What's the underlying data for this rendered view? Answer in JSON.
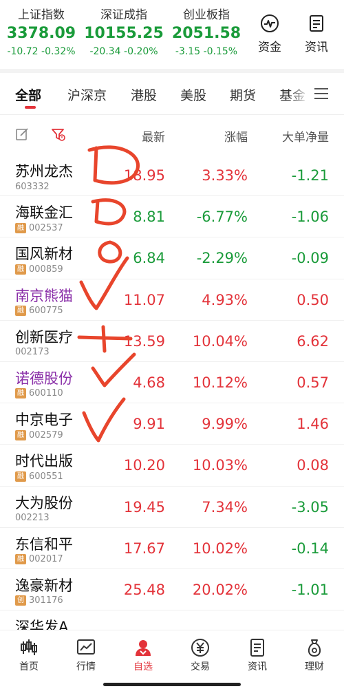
{
  "indices": [
    {
      "name": "上证指数",
      "value": "3378.09",
      "change": "-10.72",
      "pct": "-0.32%"
    },
    {
      "name": "深证成指",
      "value": "10155.25",
      "change": "-20.34",
      "pct": "-0.20%"
    },
    {
      "name": "创业板指",
      "value": "2051.58",
      "change": "-3.15",
      "pct": "-0.15%"
    }
  ],
  "top_buttons": {
    "funds": "资金",
    "news": "资讯"
  },
  "tabs": [
    "全部",
    "沪深京",
    "港股",
    "美股",
    "期货",
    "基金"
  ],
  "header": {
    "latest": "最新",
    "change": "涨幅",
    "net": "大单净量"
  },
  "stocks": [
    {
      "name": "苏州龙杰",
      "code": "603332",
      "tag": "",
      "price": "18.95",
      "pct": "3.33%",
      "net": "-1.21"
    },
    {
      "name": "海联金汇",
      "code": "002537",
      "tag": "融",
      "price": "8.81",
      "pct": "-6.77%",
      "net": "-1.06"
    },
    {
      "name": "国风新材",
      "code": "000859",
      "tag": "融",
      "price": "6.84",
      "pct": "-2.29%",
      "net": "-0.09"
    },
    {
      "name": "南京熊猫",
      "code": "600775",
      "tag": "融",
      "price": "11.07",
      "pct": "4.93%",
      "net": "0.50"
    },
    {
      "name": "创新医疗",
      "code": "002173",
      "tag": "",
      "price": "13.59",
      "pct": "10.04%",
      "net": "6.62"
    },
    {
      "name": "诺德股份",
      "code": "600110",
      "tag": "融",
      "price": "4.68",
      "pct": "10.12%",
      "net": "0.57"
    },
    {
      "name": "中京电子",
      "code": "002579",
      "tag": "融",
      "price": "9.91",
      "pct": "9.99%",
      "net": "1.46"
    },
    {
      "name": "时代出版",
      "code": "600551",
      "tag": "融",
      "price": "10.20",
      "pct": "10.03%",
      "net": "0.08"
    },
    {
      "name": "大为股份",
      "code": "002213",
      "tag": "",
      "price": "19.45",
      "pct": "7.34%",
      "net": "-3.05"
    },
    {
      "name": "东信和平",
      "code": "002017",
      "tag": "融",
      "price": "17.67",
      "pct": "10.02%",
      "net": "-0.14"
    },
    {
      "name": "逸豪新材",
      "code": "301176",
      "tag": "创",
      "price": "25.48",
      "pct": "20.02%",
      "net": "-1.01"
    },
    {
      "name": "深华发A",
      "code": "",
      "tag": "",
      "price": "",
      "pct": "",
      "net": ""
    }
  ],
  "nav": [
    {
      "label": "首页",
      "icon": "candlestick-icon"
    },
    {
      "label": "行情",
      "icon": "chart-icon"
    },
    {
      "label": "自选",
      "icon": "person-icon"
    },
    {
      "label": "交易",
      "icon": "yuan-icon"
    },
    {
      "label": "资讯",
      "icon": "news-icon"
    },
    {
      "label": "理财",
      "icon": "moneybag-icon"
    }
  ],
  "colors": {
    "up": "#e3333a",
    "down": "#1a9b3a",
    "accent": "#e3333a",
    "purple": "#8a2fa8",
    "ink": "#e8452c"
  }
}
